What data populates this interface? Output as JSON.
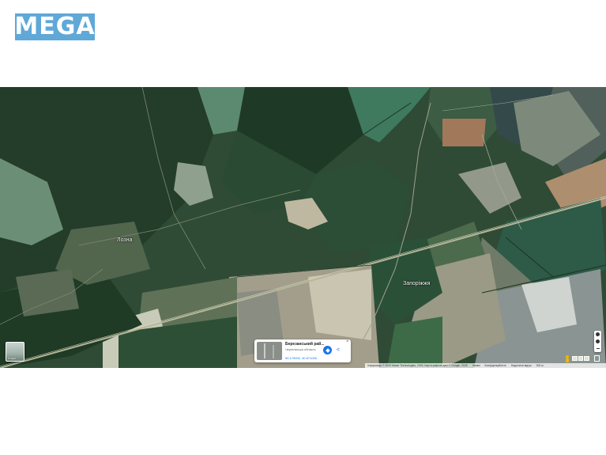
{
  "header": {
    "logo_text": "MEGA"
  },
  "map": {
    "type": "satellite",
    "places": [
      {
        "name": "Лозна"
      },
      {
        "name": "Запоріжжя"
      }
    ],
    "info_card": {
      "title": "Березанський рай...",
      "subtitle": "Чернігівська область",
      "coordinates": "50.179000, 30.571000",
      "directions_icon": "directions-icon",
      "share_icon": "share-icon",
      "close_label": "×"
    },
    "layers_label": "Шари",
    "controls": {
      "zoom_in": "+",
      "zoom_out": "−"
    },
    "attribution": {
      "data": "Інформація © 2025 Maxar Technologies, 2025, Картографічні дані © Google, 2025",
      "terms": "Умови",
      "privacy": "Конфіденційність",
      "report": "Надіслати відгук",
      "scale": "200 м"
    }
  }
}
